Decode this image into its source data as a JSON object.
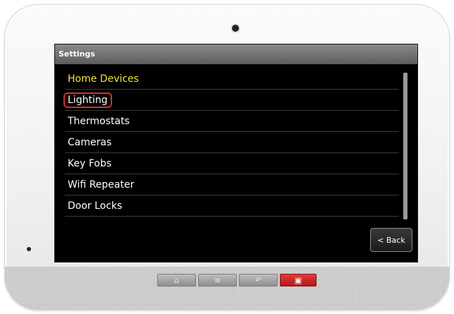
{
  "screen": {
    "title": "Settings",
    "menu": {
      "header": "Home Devices",
      "items": [
        {
          "label": "Lighting",
          "highlighted": true
        },
        {
          "label": "Thermostats"
        },
        {
          "label": "Cameras"
        },
        {
          "label": "Key Fobs"
        },
        {
          "label": "Wifi Repeater"
        },
        {
          "label": "Door Locks"
        }
      ]
    },
    "back_label": "< Back"
  },
  "hardware_buttons": [
    {
      "name": "home-icon",
      "glyph": "⌂"
    },
    {
      "name": "menu-icon",
      "glyph": "≡"
    },
    {
      "name": "return-icon",
      "glyph": "↶"
    },
    {
      "name": "emergency-icon",
      "glyph": "▣"
    }
  ],
  "colors": {
    "header_text": "#f2e53a",
    "highlight_border": "#d32f2f",
    "alert_button": "#c62828"
  }
}
